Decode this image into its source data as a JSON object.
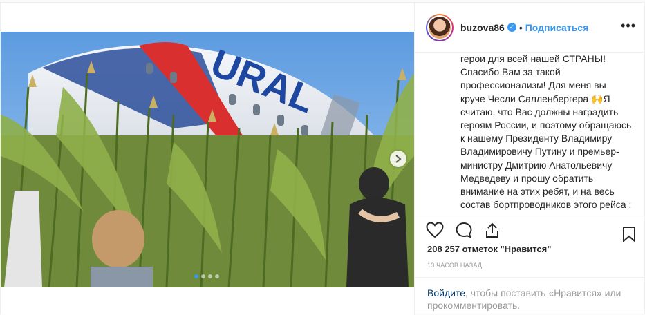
{
  "header": {
    "username": "buzova86",
    "separator": "•",
    "follow_label": "Подписаться",
    "more_icon": "•••"
  },
  "caption": {
    "text": "герои для всей нашей СТРАНЫ! Спасибо Вам за такой профессионализм! Для меня вы круче Чесли Салленбергера 🙌Я считаю, что Вас должны наградить героям России, и поэтому обращаюсь к нашему Президенту Владимиру Владимировичу Путину и премьер-министру Дмитрию Анатольевичу Медведеву и прошу обратить внимание на этих ребят, и на весь состав бортпроводников этого рейса : Дмитрия Ивлицкого,"
  },
  "stats": {
    "likes": "208 257 отметок \"Нравится\"",
    "time": "13 ЧАСОВ НАЗАД"
  },
  "login_prompt": {
    "link": "Войдите",
    "rest": ", чтобы поставить «Нравится» или прокомментировать."
  },
  "colors": {
    "accent": "#3897f0",
    "text": "#262626",
    "muted": "#999999"
  }
}
